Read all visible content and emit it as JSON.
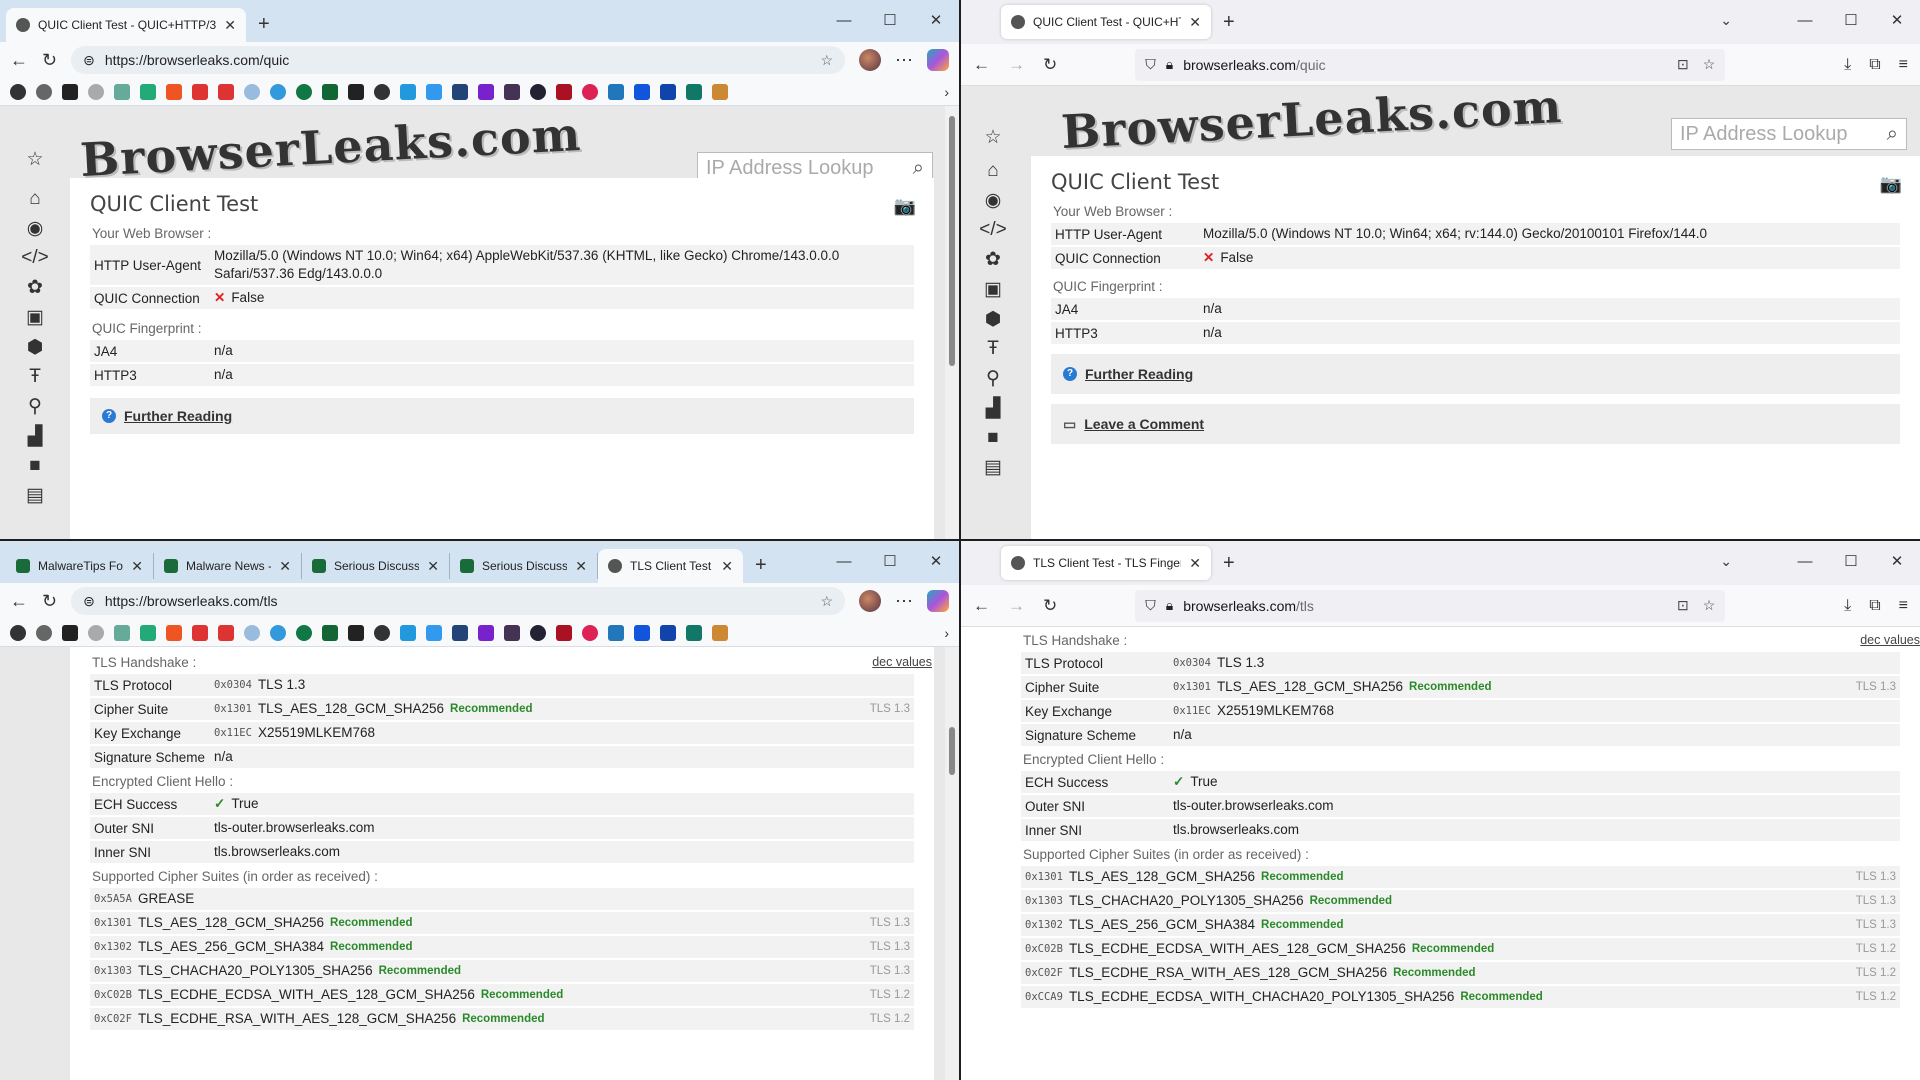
{
  "w1": {
    "tab_title": "QUIC Client Test - QUIC+HTTP/3",
    "url": "https://browserleaks.com/quic",
    "logo": "BrowserLeaks.com",
    "search_placeholder": "IP Address Lookup",
    "heading": "QUIC Client Test",
    "sec_browser": "Your Web Browser :",
    "ua_label": "HTTP User-Agent",
    "ua_value": "Mozilla/5.0 (Windows NT 10.0; Win64; x64) AppleWebKit/537.36 (KHTML, like Gecko) Chrome/143.0.0.0 Safari/537.36 Edg/143.0.0.0",
    "quic_label": "QUIC Connection",
    "quic_value": "False",
    "sec_fp": "QUIC Fingerprint :",
    "ja4_label": "JA4",
    "ja4_value": "n/a",
    "http3_label": "HTTP3",
    "http3_value": "n/a",
    "further": "Further Reading"
  },
  "w2": {
    "tab_title": "QUIC Client Test - QUIC+HTTP/",
    "url_host": "browserleaks.com",
    "url_path": "/quic",
    "logo": "BrowserLeaks.com",
    "search_placeholder": "IP Address Lookup",
    "heading": "QUIC Client Test",
    "sec_browser": "Your Web Browser :",
    "ua_label": "HTTP User-Agent",
    "ua_value": "Mozilla/5.0 (Windows NT 10.0; Win64; x64; rv:144.0) Gecko/20100101 Firefox/144.0",
    "quic_label": "QUIC Connection",
    "quic_value": "False",
    "sec_fp": "QUIC Fingerprint :",
    "ja4_label": "JA4",
    "ja4_value": "n/a",
    "http3_label": "HTTP3",
    "http3_value": "n/a",
    "further": "Further Reading",
    "comment": "Leave a Comment"
  },
  "w3": {
    "tabs": [
      "MalwareTips Fo",
      "Malware News -",
      "Serious Discuss",
      "Serious Discuss",
      "TLS Client Test -"
    ],
    "url": "https://browserleaks.com/tls",
    "sec_handshake": "TLS Handshake :",
    "dec_values": "dec values",
    "handshake": [
      {
        "k": "TLS Protocol",
        "hex": "0x0304",
        "v": "TLS 1.3",
        "rec": "",
        "ver": ""
      },
      {
        "k": "Cipher Suite",
        "hex": "0x1301",
        "v": "TLS_AES_128_GCM_SHA256",
        "rec": "Recommended",
        "ver": "TLS 1.3"
      },
      {
        "k": "Key Exchange",
        "hex": "0x11EC",
        "v": "X25519MLKEM768",
        "rec": "",
        "ver": ""
      },
      {
        "k": "Signature Scheme",
        "hex": "",
        "v": "n/a",
        "rec": "",
        "ver": ""
      }
    ],
    "sec_ech": "Encrypted Client Hello :",
    "ech": [
      {
        "k": "ECH Success",
        "v": "True"
      },
      {
        "k": "Outer SNI",
        "v": "tls-outer.browserleaks.com"
      },
      {
        "k": "Inner SNI",
        "v": "tls.browserleaks.com"
      }
    ],
    "sec_ciphers": "Supported Cipher Suites (in order as received) :",
    "ciphers": [
      {
        "hex": "0x5A5A",
        "v": "GREASE",
        "rec": "",
        "ver": ""
      },
      {
        "hex": "0x1301",
        "v": "TLS_AES_128_GCM_SHA256",
        "rec": "Recommended",
        "ver": "TLS 1.3"
      },
      {
        "hex": "0x1302",
        "v": "TLS_AES_256_GCM_SHA384",
        "rec": "Recommended",
        "ver": "TLS 1.3"
      },
      {
        "hex": "0x1303",
        "v": "TLS_CHACHA20_POLY1305_SHA256",
        "rec": "Recommended",
        "ver": "TLS 1.3"
      },
      {
        "hex": "0xC02B",
        "v": "TLS_ECDHE_ECDSA_WITH_AES_128_GCM_SHA256",
        "rec": "Recommended",
        "ver": "TLS 1.2"
      },
      {
        "hex": "0xC02F",
        "v": "TLS_ECDHE_RSA_WITH_AES_128_GCM_SHA256",
        "rec": "Recommended",
        "ver": "TLS 1.2"
      }
    ]
  },
  "w4": {
    "tab_title": "TLS Client Test - TLS Fingerprint",
    "url_host": "browserleaks.com",
    "url_path": "/tls",
    "sec_handshake": "TLS Handshake :",
    "dec_values": "dec values",
    "handshake": [
      {
        "k": "TLS Protocol",
        "hex": "0x0304",
        "v": "TLS 1.3",
        "rec": "",
        "ver": ""
      },
      {
        "k": "Cipher Suite",
        "hex": "0x1301",
        "v": "TLS_AES_128_GCM_SHA256",
        "rec": "Recommended",
        "ver": "TLS 1.3"
      },
      {
        "k": "Key Exchange",
        "hex": "0x11EC",
        "v": "X25519MLKEM768",
        "rec": "",
        "ver": ""
      },
      {
        "k": "Signature Scheme",
        "hex": "",
        "v": "n/a",
        "rec": "",
        "ver": ""
      }
    ],
    "sec_ech": "Encrypted Client Hello :",
    "ech": [
      {
        "k": "ECH Success",
        "v": "True"
      },
      {
        "k": "Outer SNI",
        "v": "tls-outer.browserleaks.com"
      },
      {
        "k": "Inner SNI",
        "v": "tls.browserleaks.com"
      }
    ],
    "sec_ciphers": "Supported Cipher Suites (in order as received) :",
    "ciphers": [
      {
        "hex": "0x1301",
        "v": "TLS_AES_128_GCM_SHA256",
        "rec": "Recommended",
        "ver": "TLS 1.3"
      },
      {
        "hex": "0x1303",
        "v": "TLS_CHACHA20_POLY1305_SHA256",
        "rec": "Recommended",
        "ver": "TLS 1.3"
      },
      {
        "hex": "0x1302",
        "v": "TLS_AES_256_GCM_SHA384",
        "rec": "Recommended",
        "ver": "TLS 1.3"
      },
      {
        "hex": "0xC02B",
        "v": "TLS_ECDHE_ECDSA_WITH_AES_128_GCM_SHA256",
        "rec": "Recommended",
        "ver": "TLS 1.2"
      },
      {
        "hex": "0xC02F",
        "v": "TLS_ECDHE_RSA_WITH_AES_128_GCM_SHA256",
        "rec": "Recommended",
        "ver": "TLS 1.2"
      },
      {
        "hex": "0xCCA9",
        "v": "TLS_ECDHE_ECDSA_WITH_CHACHA20_POLY1305_SHA256",
        "rec": "Recommended",
        "ver": "TLS 1.2"
      }
    ]
  },
  "colors": {
    "recommended": "#2a8a2a",
    "false_mark": "#d22",
    "edge_tabbar": "#d3e3f1",
    "ff_tabbar": "#f0f0f4"
  }
}
